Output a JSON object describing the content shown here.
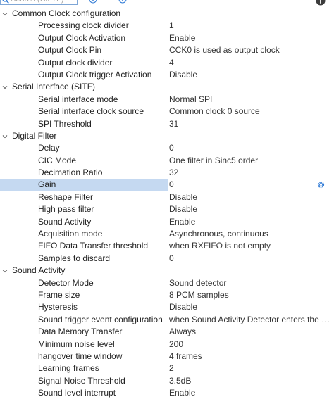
{
  "search": {
    "placeholder": "Search (Ctrl+F)"
  },
  "toolbar": {
    "prev_icon": "circle-arrow-left-icon",
    "next_icon": "circle-arrow-right-icon",
    "info_icon": "info-icon"
  },
  "colors": {
    "selection": "#c5d9f1",
    "accent": "#2f7ad6"
  },
  "groups": [
    {
      "label": "Common Clock configuration",
      "expanded": true,
      "params": [
        {
          "label": "Processing clock divider",
          "value": "1"
        },
        {
          "label": "Output Clock Activation",
          "value": "Enable"
        },
        {
          "label": "Output Clock Pin",
          "value": "CCK0 is used as output clock"
        },
        {
          "label": "Output clock divider",
          "value": "4"
        },
        {
          "label": "Output Clock trigger Activation",
          "value": "Disable"
        }
      ]
    },
    {
      "label": "Serial Interface (SITF)",
      "expanded": true,
      "params": [
        {
          "label": "Serial interface mode",
          "value": "Normal SPI"
        },
        {
          "label": "Serial interface clock source",
          "value": "Common clock 0 source"
        },
        {
          "label": "SPI Threshold",
          "value": "31"
        }
      ]
    },
    {
      "label": "Digital Filter",
      "expanded": true,
      "params": [
        {
          "label": "Delay",
          "value": "0"
        },
        {
          "label": "CIC Mode",
          "value": "One filter in Sinc5 order"
        },
        {
          "label": "Decimation Ratio",
          "value": "32"
        },
        {
          "label": "Gain",
          "value": "0",
          "selected": true
        },
        {
          "label": "Reshape Filter",
          "value": "Disable"
        },
        {
          "label": "High pass filter",
          "value": "Disable"
        },
        {
          "label": "Sound Activity",
          "value": "Enable"
        },
        {
          "label": "Acquisition mode",
          "value": "Asynchronous, continuous"
        },
        {
          "label": "FIFO Data Transfer threshold",
          "value": "when RXFIFO is not empty"
        },
        {
          "label": "Samples to discard",
          "value": "0"
        }
      ]
    },
    {
      "label": "Sound Activity",
      "expanded": true,
      "params": [
        {
          "label": "Detector Mode",
          "value": "Sound detector"
        },
        {
          "label": "Frame size",
          "value": "8 PCM samples"
        },
        {
          "label": "Hysteresis",
          "value": "Disable"
        },
        {
          "label": "Sound trigger event configuration",
          "value": "when Sound Activity Detector enters the MO..."
        },
        {
          "label": "Data Memory Transfer",
          "value": "Always"
        },
        {
          "label": "Minimum noise level",
          "value": "200"
        },
        {
          "label": "hangover time window",
          "value": "4 frames"
        },
        {
          "label": "Learning frames",
          "value": "2"
        },
        {
          "label": "Signal Noise Threshold",
          "value": "3.5dB"
        },
        {
          "label": "Sound level interrupt",
          "value": "Enable"
        }
      ]
    }
  ]
}
